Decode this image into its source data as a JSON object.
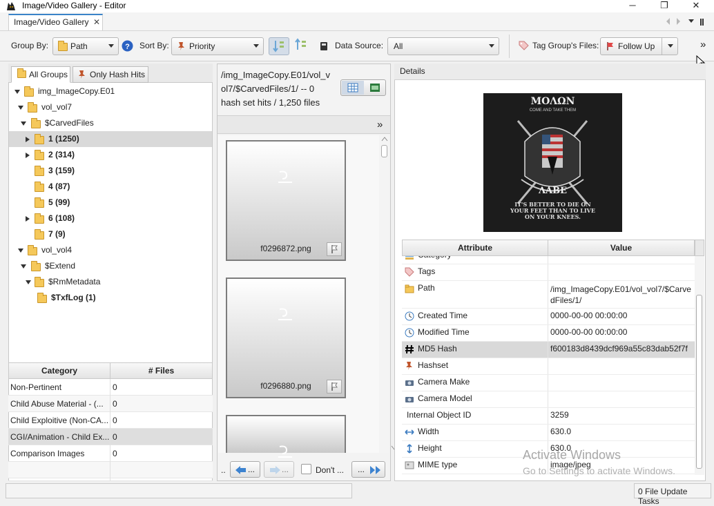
{
  "window": {
    "title": "Image/Video Gallery - Editor",
    "minimize": "─",
    "maximize": "❐",
    "close": "✕"
  },
  "tabs": [
    {
      "label": "Image/Video Gallery",
      "close": "✕"
    }
  ],
  "toolbar": {
    "group_by_label": "Group By:",
    "group_by_value": "Path",
    "sort_by_label": "Sort By:",
    "sort_by_value": "Priority",
    "data_source_label": "Data Source:",
    "data_source_value": "All",
    "tag_label": "Tag Group's Files:",
    "tag_value": "Follow Up",
    "overflow": "»"
  },
  "group_tabs": [
    {
      "label": "All Groups",
      "selected": true
    },
    {
      "label": "Only Hash Hits",
      "selected": false
    }
  ],
  "tree": [
    {
      "label": "img_ImageCopy.E01",
      "expanded": true,
      "level": 0,
      "bold": false
    },
    {
      "label": "vol_vol7",
      "expanded": true,
      "level": 1,
      "bold": false
    },
    {
      "label": "$CarvedFiles",
      "expanded": true,
      "level": 2,
      "bold": false
    },
    {
      "label": "1 (1250)",
      "expanded": false,
      "level": 3,
      "bold": true,
      "selected": true,
      "arrow": true
    },
    {
      "label": "2 (314)",
      "level": 3,
      "bold": true,
      "arrow": true
    },
    {
      "label": "3 (159)",
      "level": 3,
      "bold": true
    },
    {
      "label": "4 (87)",
      "level": 3,
      "bold": true
    },
    {
      "label": "5 (99)",
      "level": 3,
      "bold": true
    },
    {
      "label": "6 (108)",
      "level": 3,
      "bold": true,
      "arrow": true
    },
    {
      "label": "7 (9)",
      "level": 3,
      "bold": true
    },
    {
      "label": "vol_vol4",
      "expanded": true,
      "level": 1,
      "bold": false
    },
    {
      "label": "$Extend",
      "expanded": true,
      "level": 2,
      "bold": false
    },
    {
      "label": "$RmMetadata",
      "expanded": true,
      "level": 3,
      "bold": false
    },
    {
      "label": "$TxfLog (1)",
      "level": 4,
      "bold": true
    }
  ],
  "category_table": {
    "headers": [
      "Category",
      "# Files"
    ],
    "rows": [
      {
        "category": "Non-Pertinent",
        "files": "0"
      },
      {
        "category": "Child Abuse Material - (...",
        "files": "0"
      },
      {
        "category": "Child Exploitive (Non-CA...",
        "files": "0"
      },
      {
        "category": "CGI/Animation - Child Ex...",
        "files": "0"
      },
      {
        "category": "Comparison Images",
        "files": "0"
      }
    ]
  },
  "group_header": {
    "line1": "/img_ImageCopy.E01/vol_v",
    "line2": "ol7/$CarvedFiles/1/ -- 0",
    "line3": "hash set hits / 1,250 files",
    "overflow": "»"
  },
  "thumbnails": [
    {
      "name": "f0296872.png"
    },
    {
      "name": "f0296880.png"
    },
    {
      "name": ""
    }
  ],
  "nav": {
    "ellipsis": "..",
    "prev": "...",
    "next": "...",
    "dont_label": "Don't ...",
    "fwd": "..."
  },
  "details": {
    "title": "Details",
    "image": {
      "top_text": "ΜΟΛΩΝ",
      "sub_text": "COME AND TAKE THEM",
      "mid_text": "ΛΑΒΕ",
      "quote1": "IT'S BETTER TO DIE ON",
      "quote2": "YOUR FEET THAN TO LIVE",
      "quote3": "ON YOUR KNEES."
    },
    "headers": [
      "Attribute",
      "Value"
    ],
    "rows": [
      {
        "attr": "Category",
        "value": "",
        "icon": "category-icon"
      },
      {
        "attr": "Tags",
        "value": "",
        "icon": "tag-icon"
      },
      {
        "attr": "Path",
        "value": "/img_ImageCopy.E01/vol_vol7/$CarvedFiles/1/",
        "icon": "folder-icon"
      },
      {
        "attr": "Created Time",
        "value": "0000-00-00 00:00:00",
        "icon": "clock-icon"
      },
      {
        "attr": "Modified Time",
        "value": "0000-00-00 00:00:00",
        "icon": "clock-icon"
      },
      {
        "attr": "MD5 Hash",
        "value": "f600183d8439dcf969a55c83dab52f7f",
        "icon": "hash-icon",
        "selected": true
      },
      {
        "attr": "Hashset",
        "value": "",
        "icon": "pin-icon"
      },
      {
        "attr": "Camera Make",
        "value": "",
        "icon": "camera-icon"
      },
      {
        "attr": "Camera Model",
        "value": "",
        "icon": "camera-icon"
      },
      {
        "attr": "Internal Object ID",
        "value": "3259",
        "icon": ""
      },
      {
        "attr": "Width",
        "value": "630.0",
        "icon": "width-icon"
      },
      {
        "attr": "Height",
        "value": "630.0",
        "icon": "height-icon"
      },
      {
        "attr": "MIME type",
        "value": "image/jpeg",
        "icon": "mime-icon"
      }
    ]
  },
  "watermark": {
    "line1": "Activate Windows",
    "line2": "Go to Settings to activate Windows."
  },
  "status": {
    "right": "0 File Update Tasks"
  },
  "colors": {
    "accent": "#3a83c8",
    "selection": "#d9d9d9",
    "folder": "#f5c85a"
  }
}
